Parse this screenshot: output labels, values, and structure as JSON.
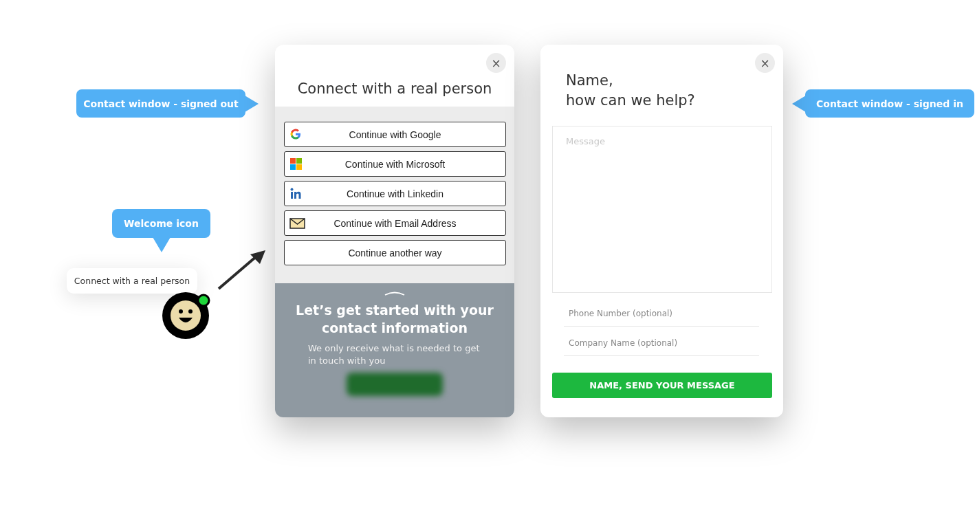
{
  "signed_out_callout": "Contact window - signed out",
  "signed_in_callout": "Contact window - signed in",
  "welcome": {
    "callout": "Welcome icon",
    "bubble": "Connect with a real person",
    "online": true
  },
  "signed_out_window": {
    "close": "×",
    "title": "Connect with a real person",
    "options": [
      {
        "kind": "google",
        "label": "Continue with Google"
      },
      {
        "kind": "microsoft",
        "label": "Continue with Microsoft"
      },
      {
        "kind": "linkedin",
        "label": "Continue with Linkedin"
      },
      {
        "kind": "email",
        "label": "Continue with Email Address"
      },
      {
        "kind": "other",
        "label": "Continue another way"
      }
    ],
    "panel": {
      "title": "Let’s get started with your contact information",
      "text": "We only receive what is needed to get in touch with you"
    }
  },
  "signed_in_window": {
    "close": "×",
    "title": "Name,\nhow can we help?",
    "message_placeholder": "Message",
    "fields": [
      {
        "placeholder": "Phone Number (optional)"
      },
      {
        "placeholder": "Company Name (optional)"
      }
    ],
    "submit": "NAME, SEND YOUR MESSAGE"
  }
}
